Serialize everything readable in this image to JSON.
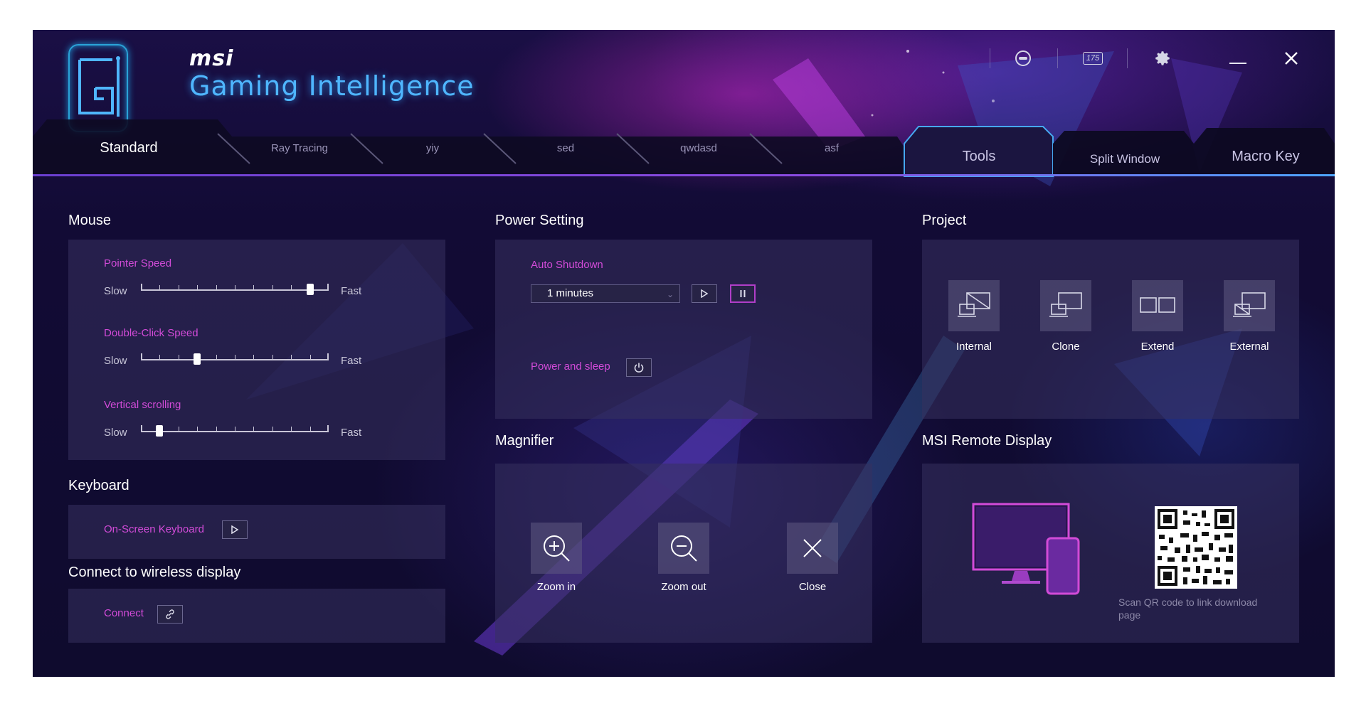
{
  "brand": {
    "msi": "msi",
    "product": "Gaming Intelligence"
  },
  "header": {
    "refresh_badge": "175",
    "icons": [
      "gamepad-icon",
      "refresh-rate-icon",
      "gear-icon",
      "minimize-icon",
      "close-icon"
    ]
  },
  "tabs": {
    "left": [
      "Standard",
      "Ray Tracing",
      "yiy",
      "sed",
      "qwdasd",
      "asf"
    ],
    "active_left": "Standard",
    "right": [
      "Tools",
      "Split Window",
      "Macro Key"
    ],
    "active_right": "Tools"
  },
  "mouse": {
    "title": "Mouse",
    "sliders": [
      {
        "label": "Pointer Speed",
        "min_label": "Slow",
        "max_label": "Fast",
        "value": 0.9
      },
      {
        "label": "Double-Click Speed",
        "min_label": "Slow",
        "max_label": "Fast",
        "value": 0.3
      },
      {
        "label": "Vertical scrolling",
        "min_label": "Slow",
        "max_label": "Fast",
        "value": 0.1
      }
    ]
  },
  "keyboard": {
    "title": "Keyboard",
    "label": "On-Screen Keyboard"
  },
  "wireless": {
    "title": "Connect to wireless display",
    "label": "Connect"
  },
  "power": {
    "title": "Power Setting",
    "auto_shutdown_label": "Auto Shutdown",
    "selected_option": "1 minutes",
    "power_sleep_label": "Power and sleep"
  },
  "magnifier": {
    "title": "Magnifier",
    "buttons": [
      "Zoom in",
      "Zoom out",
      "Close"
    ]
  },
  "project": {
    "title": "Project",
    "options": [
      "Internal",
      "Clone",
      "Extend",
      "External"
    ]
  },
  "remote": {
    "title": "MSI Remote Display",
    "caption": "Scan QR code to link download page"
  },
  "colors": {
    "accent": "#d24bd8",
    "brand_blue": "#4fb6ff",
    "background": "#120b35"
  }
}
